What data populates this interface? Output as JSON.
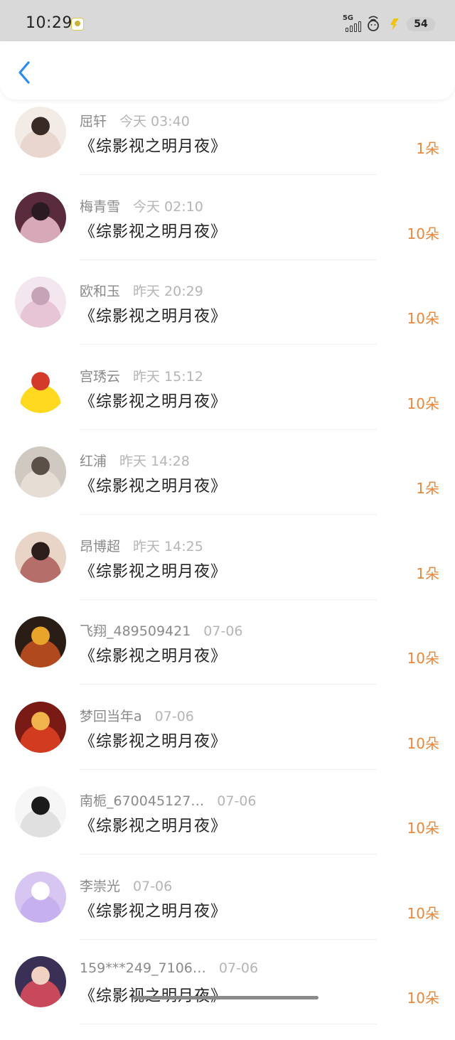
{
  "status_bar": {
    "time": "10:29",
    "network": "5G",
    "battery": "54",
    "icons": [
      "app-notification-icon",
      "signal-icon",
      "hotspot-icon",
      "flash-charge-icon",
      "battery-icon"
    ]
  },
  "nav": {
    "back_icon": "chevron-left-icon",
    "accent": "#2a8cf0"
  },
  "colors": {
    "amount": "#e8873a",
    "name": "#8a8a8a",
    "time": "#b5b5b5",
    "title": "#222222"
  },
  "items": [
    {
      "name": "屈轩",
      "time": "今天 03:40",
      "title": "《综影视之明月夜》",
      "amount": "1朵",
      "avatar_colors": [
        "#f3ebe6",
        "#e9d6cf",
        "#3a2a26"
      ]
    },
    {
      "name": "梅青雪",
      "time": "今天 02:10",
      "title": "《综影视之明月夜》",
      "amount": "10朵",
      "avatar_colors": [
        "#5a2a3d",
        "#d6a8b8",
        "#2a1a22"
      ]
    },
    {
      "name": "欧和玉",
      "time": "昨天 20:29",
      "title": "《综影视之明月夜》",
      "amount": "10朵",
      "avatar_colors": [
        "#f4e6ef",
        "#e7c5d6",
        "#c7a3b7"
      ]
    },
    {
      "name": "宫琇云",
      "time": "昨天 15:12",
      "title": "《综影视之明月夜》",
      "amount": "10朵",
      "avatar_colors": [
        "#ffffff",
        "#ffd820",
        "#d43a2a"
      ]
    },
    {
      "name": "红浦",
      "time": "昨天 14:28",
      "title": "《综影视之明月夜》",
      "amount": "1朵",
      "avatar_colors": [
        "#cfc9c2",
        "#e6ddd4",
        "#5a5048"
      ]
    },
    {
      "name": "昂博超",
      "time": "昨天 14:25",
      "title": "《综影视之明月夜》",
      "amount": "1朵",
      "avatar_colors": [
        "#e8d5c8",
        "#b66e6a",
        "#2b1d1a"
      ]
    },
    {
      "name": "飞翔_489509421",
      "time": "07-06",
      "title": "《综影视之明月夜》",
      "amount": "10朵",
      "avatar_colors": [
        "#2a1d16",
        "#b04a1e",
        "#e8a52a"
      ]
    },
    {
      "name": "梦回当年a",
      "time": "07-06",
      "title": "《综影视之明月夜》",
      "amount": "10朵",
      "avatar_colors": [
        "#7a1a14",
        "#d13b20",
        "#f1b44a"
      ]
    },
    {
      "name": "南栀_670045127…",
      "time": "07-06",
      "title": "《综影视之明月夜》",
      "amount": "10朵",
      "avatar_colors": [
        "#f6f6f6",
        "#e0e0e0",
        "#1a1a1a"
      ]
    },
    {
      "name": "李崇光",
      "time": "07-06",
      "title": "《综影视之明月夜》",
      "amount": "10朵",
      "avatar_colors": [
        "#d8c6f2",
        "#c7b0ee",
        "#ffffff"
      ]
    },
    {
      "name": "159***249_7106…",
      "time": "07-06",
      "title": "《综影视之明月夜》",
      "amount": "10朵",
      "avatar_colors": [
        "#3a2f55",
        "#c84a5a",
        "#f0d2c2"
      ]
    }
  ]
}
